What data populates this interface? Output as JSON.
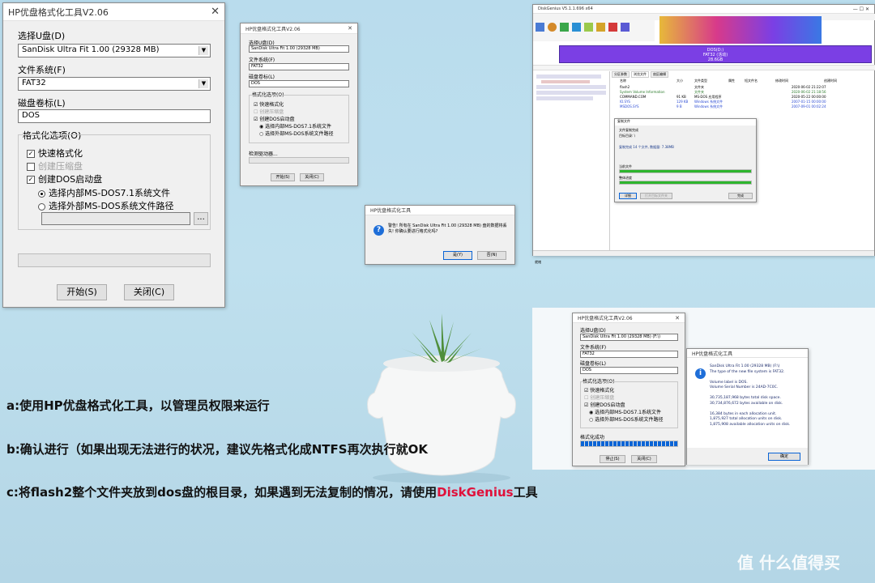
{
  "dlg1": {
    "title": "HP优盘格式化工具V2.06",
    "close": "✕",
    "device_label": "选择U盘(D)",
    "device_value": "SanDisk Ultra Fit 1.00 (29328 MB)",
    "fs_label": "文件系统(F)",
    "fs_value": "FAT32",
    "volume_label": "磁盘卷标(L)",
    "volume_value": "DOS",
    "options_label": "格式化选项(O)",
    "quick": "快速格式化",
    "compress": "创建压缩盘",
    "dos": "创建DOS启动盘",
    "internal": "选择内部MS-DOS7.1系统文件",
    "external": "选择外部MS-DOS系统文件路径",
    "browse": "...",
    "start": "开始(S)",
    "close_btn": "关闭(C)"
  },
  "dlg2": {
    "title": "HP优盘格式化工具V2.06",
    "device_label": "选择U盘(D)",
    "device_value": "SanDisk Ultra Fit 1.00 (29328 MB)",
    "fs_label": "文件系统(F)",
    "fs_value": "FAT32",
    "volume_label": "磁盘卷标(L)",
    "volume_value": "DOS",
    "options_label": "格式化选项(O)",
    "quick": "快速格式化",
    "compress": "创建压缩盘",
    "dos": "创建DOS启动盘",
    "internal": "选择内部MS-DOS7.1系统文件",
    "external": "选择外部MS-DOS系统文件路径",
    "status": "检测驱动器...",
    "start": "开始(S)",
    "close_btn": "关闭(C)"
  },
  "confirm": {
    "title": "HP优盘格式化工具",
    "message": "警告! 所有在 SanDisk Ultra Fit 1.00 (29328 MB) 盘的数据将丢失! 你确认要进行格式化吗?",
    "yes": "是(Y)",
    "no": "否(N)"
  },
  "diskgenius": {
    "title": "DiskGenius V5.1.1.696 x64",
    "partition_name": "DOS(D:)",
    "partition_fs": "FAT32 (活动)",
    "partition_size": "28.6GB",
    "tabs": [
      "分区参数",
      "浏览文件",
      "扇区编辑"
    ],
    "columns": [
      "名称",
      "大小",
      "文件类型",
      "属性",
      "短文件名",
      "修改时间",
      "创建时间"
    ],
    "files": [
      {
        "name": "flash2",
        "size": "",
        "type": "文件夹",
        "date": "2020-06-02 21:22:07"
      },
      {
        "name": "System Volume Information",
        "size": "",
        "type": "文件夹",
        "date": "2020-06-02 21:18:56"
      },
      {
        "name": "COMMAND.COM",
        "size": "91 KB",
        "type": "MS-DOS 应用程序",
        "date": "2020-05-22 00:00:00"
      },
      {
        "name": "IO.SYS",
        "size": "129 KB",
        "type": "Windows 系统文件",
        "date": "2007-01-15 00:00:00"
      },
      {
        "name": "MSDOS.SYS",
        "size": "9 B",
        "type": "Windows 系统文件",
        "date": "2007-09-01 00:02:24"
      }
    ],
    "copy_title": "复制文件",
    "copy_status": "文件复制完成",
    "copy_target": "目标目录: \\",
    "copy_summary": "复制完成 14 个文件, 数据量: 7.38MB",
    "current_file": "当前文件",
    "overall": "整体进度",
    "copy_progress": 1.0,
    "overall_progress": 1.0,
    "copy_buttons": [
      "详细",
      "打开目标文件夹",
      "完成"
    ],
    "status_left": "就绪"
  },
  "dlg3": {
    "title": "HP优盘格式化工具V2.06",
    "device_label": "选择U盘(D)",
    "device_value": "SanDisk Ultra Fit 1.00 (29328 MB) (F:\\)",
    "fs_label": "文件系统(F)",
    "fs_value": "FAT32",
    "volume_label": "磁盘卷标(L)",
    "volume_value": "DOS",
    "options_label": "格式化选项(O)",
    "quick": "快速格式化",
    "compress": "创建压缩盘",
    "dos": "创建DOS启动盘",
    "internal": "选择内部MS-DOS7.1系统文件",
    "external": "选择外部MS-DOS系统文件路径",
    "status": "格式化成功",
    "progress": 1.0,
    "stop": "停止(S)",
    "close_btn": "关闭(C)"
  },
  "result": {
    "title": "HP优盘格式化工具",
    "lines": [
      "SanDisk Ultra Fit 1.00 (29328 MB) (F:\\)",
      "The type of the new file system is FAT32.",
      "",
      "Volume label is DOS.",
      "Volume Serial Number is 24AD-7C0C.",
      "",
      "30,735,187,968 bytes total disk space.",
      "30,734,876,672 bytes available on disk.",
      "",
      "16,384 bytes in each allocation unit.",
      "1,875,927 total allocation units on disk.",
      "1,875,908 available allocation units on disk."
    ],
    "ok": "确定"
  },
  "captions": {
    "a": "a:使用HP优盘格式化工具，以管理员权限来运行",
    "b": "b:确认进行（如果出现无法进行的状况，建议先格式化成NTFS再次执行就OK",
    "c_prefix": "c:将flash2整个文件夹放到dos盘的根目录，如果遇到无法复制的情况，请使用",
    "c_highlight": "DiskGenius",
    "c_suffix": "工具"
  },
  "watermark": "值 什么值得买",
  "colors": {
    "highlight": "#e0103a",
    "progress_green": "#2db52d",
    "progress_blue": "#0a64d6",
    "partition_purple": "#7b3fe4"
  }
}
